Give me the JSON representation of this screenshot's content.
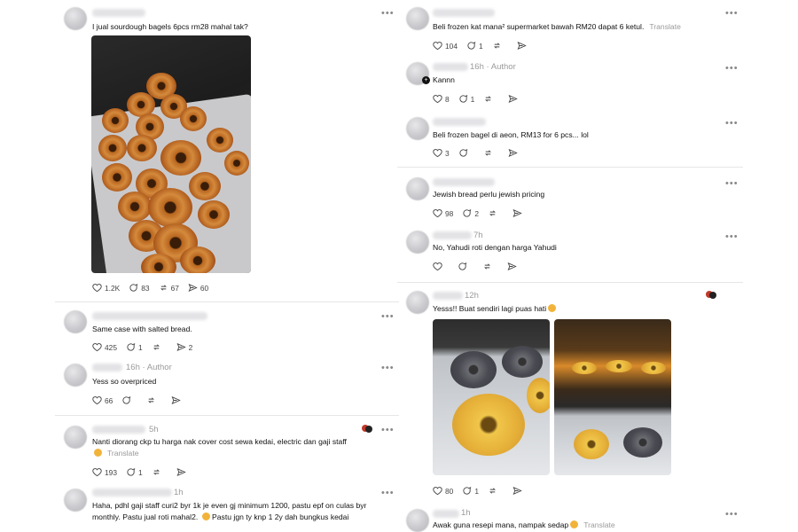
{
  "left": {
    "posts": [
      {
        "text": "I jual sourdough bagels 6pcs rm28 mahal tak?",
        "actions": {
          "likes": "1.2K",
          "replies": "83",
          "reposts": "67",
          "shares": "60"
        }
      },
      {
        "text": "Same case with salted bread.",
        "actions": {
          "likes": "425",
          "replies": "1",
          "reposts": "",
          "shares": "2"
        }
      },
      {
        "meta": "16h · Author",
        "text": "Yess so overpriced",
        "actions": {
          "likes": "66",
          "replies": "",
          "reposts": "",
          "shares": ""
        }
      },
      {
        "meta": "5h",
        "text": "Nanti diorang ckp tu harga nak cover cost sewa kedai, electric dan gaji staff",
        "translate": "Translate",
        "actions": {
          "likes": "193",
          "replies": "1",
          "reposts": "",
          "shares": ""
        }
      },
      {
        "meta": "1h",
        "text_line1": "Haha, pdhl gaji staff curi2 byr 1k je even gj minimum 1200, pastu epf on culas byr",
        "text_line2": "monthly. Pastu jual roti mahal2.",
        "text_line2b": "Pastu jgn ty knp 1 2y dah bungkus kedai"
      }
    ]
  },
  "right": {
    "posts": [
      {
        "text": "Beli frozen kat mana² supermarket bawah RM20 dapat 6 ketul.",
        "translate": "Translate",
        "actions": {
          "likes": "104",
          "replies": "1",
          "reposts": "",
          "shares": ""
        }
      },
      {
        "meta": "16h · Author",
        "text": "Kannn",
        "actions": {
          "likes": "8",
          "replies": "1",
          "reposts": "",
          "shares": ""
        }
      },
      {
        "text": "Beli frozen bagel di aeon, RM13 for 6 pcs... lol",
        "actions": {
          "likes": "3",
          "replies": "",
          "reposts": "",
          "shares": ""
        }
      },
      {
        "text": "Jewish bread perlu jewish pricing",
        "actions": {
          "likes": "98",
          "replies": "2",
          "reposts": "",
          "shares": ""
        }
      },
      {
        "meta": "7h",
        "text": "No, Yahudi roti dengan harga Yahudi",
        "actions": {
          "likes": "",
          "replies": "",
          "reposts": "",
          "shares": ""
        }
      },
      {
        "meta": "12h",
        "text": "Yesss!! Buat sendiri lagi puas hati",
        "actions": {
          "likes": "80",
          "replies": "1",
          "reposts": "",
          "shares": ""
        }
      },
      {
        "meta": "1h",
        "text": "Awak guna resepi mana, nampak sedap",
        "translate": "Translate"
      }
    ]
  },
  "more_label": "•••",
  "colors": {
    "text": "#111111",
    "muted": "#9a9a9a",
    "divider": "#e6e6e6"
  }
}
